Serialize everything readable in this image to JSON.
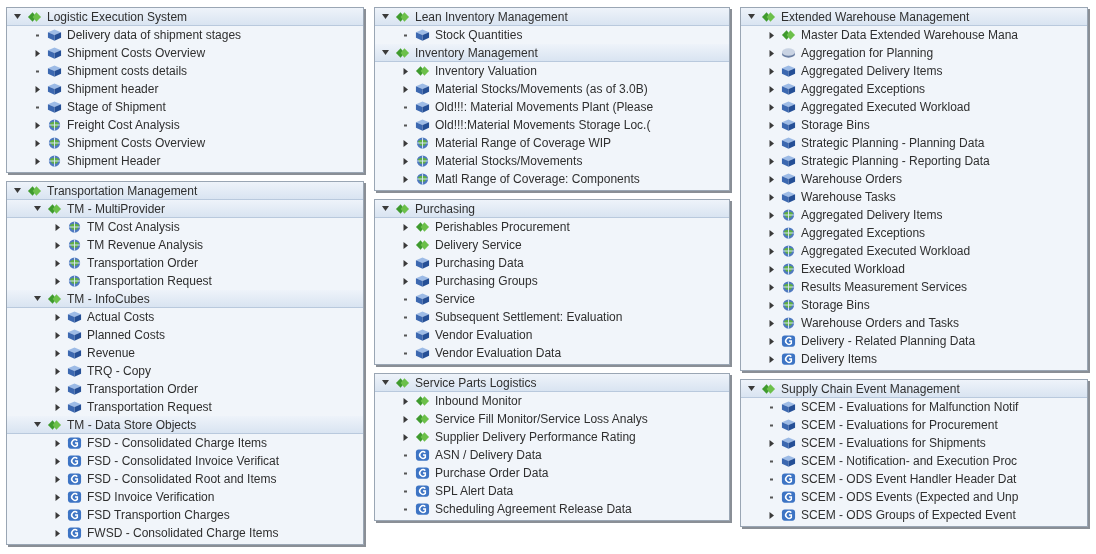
{
  "columns": [
    {
      "panels": [
        {
          "nodes": [
            {
              "label": "Logistic Execution System",
              "kind": "area",
              "expanded": true,
              "children": [
                {
                  "label": "Delivery data of shipment stages",
                  "kind": "cube",
                  "leaf": true
                },
                {
                  "label": "Shipment Costs Overview",
                  "kind": "cube",
                  "expanded": false
                },
                {
                  "label": "Shipment costs details",
                  "kind": "cube",
                  "leaf": true
                },
                {
                  "label": "Shipment header",
                  "kind": "cube",
                  "expanded": false
                },
                {
                  "label": "Stage of Shipment",
                  "kind": "cube",
                  "leaf": true
                },
                {
                  "label": "Freight Cost Analysis",
                  "kind": "multiprovider",
                  "expanded": false
                },
                {
                  "label": "Shipment Costs Overview",
                  "kind": "multiprovider",
                  "expanded": false
                },
                {
                  "label": "Shipment Header",
                  "kind": "multiprovider",
                  "expanded": false
                }
              ]
            }
          ]
        },
        {
          "nodes": [
            {
              "label": "Transportation Management",
              "kind": "area",
              "expanded": true,
              "children": [
                {
                  "label": "TM - MultiProvider",
                  "kind": "area",
                  "expanded": true,
                  "children": [
                    {
                      "label": "TM Cost Analysis",
                      "kind": "multiprovider",
                      "expanded": false
                    },
                    {
                      "label": "TM Revenue Analysis",
                      "kind": "multiprovider",
                      "expanded": false
                    },
                    {
                      "label": "Transportation Order",
                      "kind": "multiprovider",
                      "expanded": false
                    },
                    {
                      "label": "Transportation Request",
                      "kind": "multiprovider",
                      "expanded": false
                    }
                  ]
                },
                {
                  "label": "TM - InfoCubes",
                  "kind": "area",
                  "expanded": true,
                  "children": [
                    {
                      "label": "Actual Costs",
                      "kind": "cube",
                      "expanded": false
                    },
                    {
                      "label": "Planned Costs",
                      "kind": "cube",
                      "expanded": false
                    },
                    {
                      "label": "Revenue",
                      "kind": "cube",
                      "expanded": false
                    },
                    {
                      "label": "TRQ - Copy",
                      "kind": "cube",
                      "expanded": false
                    },
                    {
                      "label": "Transportation Order",
                      "kind": "cube",
                      "expanded": false
                    },
                    {
                      "label": "Transportation Request",
                      "kind": "cube",
                      "expanded": false
                    }
                  ]
                },
                {
                  "label": "TM - Data Store Objects",
                  "kind": "area",
                  "expanded": true,
                  "children": [
                    {
                      "label": "FSD - Consolidated Charge Items",
                      "kind": "dso",
                      "expanded": false
                    },
                    {
                      "label": "FSD - Consolidated Invoice Verificat",
                      "kind": "dso",
                      "expanded": false
                    },
                    {
                      "label": "FSD - Consolidated Root and Items",
                      "kind": "dso",
                      "expanded": false
                    },
                    {
                      "label": "FSD Invoice Verification",
                      "kind": "dso",
                      "expanded": false
                    },
                    {
                      "label": "FSD Transportion Charges",
                      "kind": "dso",
                      "expanded": false
                    },
                    {
                      "label": "FWSD - Consolidated Charge Items",
                      "kind": "dso",
                      "expanded": false
                    }
                  ]
                }
              ]
            }
          ]
        }
      ]
    },
    {
      "panels": [
        {
          "nodes": [
            {
              "label": "Lean Inventory Management",
              "kind": "area",
              "expanded": true,
              "children": [
                {
                  "label": "Stock Quantities",
                  "kind": "cube",
                  "leaf": true
                }
              ]
            },
            {
              "label": "Inventory Management",
              "kind": "area",
              "expanded": true,
              "children": [
                {
                  "label": "Inventory Valuation",
                  "kind": "area",
                  "expanded": false
                },
                {
                  "label": "Material Stocks/Movements (as of 3.0B)",
                  "kind": "cube",
                  "expanded": false
                },
                {
                  "label": "Old!!!: Material Movements Plant (Please",
                  "kind": "cube",
                  "leaf": true
                },
                {
                  "label": "Old!!!:Material Movements Storage Loc.(",
                  "kind": "cube",
                  "leaf": true
                },
                {
                  "label": "Material Range of Coverage WIP",
                  "kind": "multiprovider",
                  "expanded": false
                },
                {
                  "label": "Material Stocks/Movements",
                  "kind": "multiprovider",
                  "expanded": false
                },
                {
                  "label": "Matl Range of Coverage: Components",
                  "kind": "multiprovider",
                  "expanded": false
                }
              ]
            }
          ]
        },
        {
          "nodes": [
            {
              "label": "Purchasing",
              "kind": "area",
              "expanded": true,
              "children": [
                {
                  "label": "Perishables Procurement",
                  "kind": "area",
                  "expanded": false
                },
                {
                  "label": "Delivery Service",
                  "kind": "area",
                  "expanded": false
                },
                {
                  "label": "Purchasing Data",
                  "kind": "cube",
                  "expanded": false
                },
                {
                  "label": "Purchasing Groups",
                  "kind": "cube",
                  "expanded": false
                },
                {
                  "label": "Service",
                  "kind": "cube",
                  "leaf": true
                },
                {
                  "label": "Subsequent Settlement: Evaluation",
                  "kind": "cube",
                  "leaf": true
                },
                {
                  "label": "Vendor Evaluation",
                  "kind": "cube",
                  "leaf": true
                },
                {
                  "label": "Vendor Evaluation Data",
                  "kind": "cube",
                  "leaf": true
                }
              ]
            }
          ]
        },
        {
          "nodes": [
            {
              "label": "Service Parts Logistics",
              "kind": "area",
              "expanded": true,
              "children": [
                {
                  "label": "Inbound Monitor",
                  "kind": "area",
                  "expanded": false
                },
                {
                  "label": "Service Fill Monitor/Service Loss Analys",
                  "kind": "area",
                  "expanded": false
                },
                {
                  "label": "Supplier Delivery Performance Rating",
                  "kind": "area",
                  "expanded": false
                },
                {
                  "label": "ASN / Delivery Data",
                  "kind": "dso",
                  "leaf": true
                },
                {
                  "label": "Purchase Order Data",
                  "kind": "dso",
                  "leaf": true
                },
                {
                  "label": "SPL Alert Data",
                  "kind": "dso",
                  "leaf": true
                },
                {
                  "label": "Scheduling Agreement Release Data",
                  "kind": "dso",
                  "leaf": true
                }
              ]
            }
          ]
        }
      ]
    },
    {
      "panels": [
        {
          "nodes": [
            {
              "label": "Extended Warehouse Management",
              "kind": "area",
              "expanded": true,
              "children": [
                {
                  "label": "Master Data Extended Warehouse Mana",
                  "kind": "area",
                  "expanded": false
                },
                {
                  "label": "Aggregation for Planning",
                  "kind": "infoset",
                  "expanded": false
                },
                {
                  "label": "Aggregated Delivery Items",
                  "kind": "cube",
                  "expanded": false
                },
                {
                  "label": "Aggregated Exceptions",
                  "kind": "cube",
                  "expanded": false
                },
                {
                  "label": "Aggregated Executed Workload",
                  "kind": "cube",
                  "expanded": false
                },
                {
                  "label": "Storage Bins",
                  "kind": "cube",
                  "expanded": false
                },
                {
                  "label": "Strategic Planning - Planning Data",
                  "kind": "cube",
                  "expanded": false
                },
                {
                  "label": "Strategic Planning - Reporting Data",
                  "kind": "cube",
                  "expanded": false
                },
                {
                  "label": "Warehouse Orders",
                  "kind": "cube",
                  "expanded": false
                },
                {
                  "label": "Warehouse Tasks",
                  "kind": "cube",
                  "expanded": false
                },
                {
                  "label": "Aggregated Delivery Items",
                  "kind": "multiprovider",
                  "expanded": false
                },
                {
                  "label": "Aggregated Exceptions",
                  "kind": "multiprovider",
                  "expanded": false
                },
                {
                  "label": "Aggregated Executed Workload",
                  "kind": "multiprovider",
                  "expanded": false
                },
                {
                  "label": "Executed Workload",
                  "kind": "multiprovider",
                  "expanded": false
                },
                {
                  "label": "Results Measurement Services",
                  "kind": "multiprovider",
                  "expanded": false
                },
                {
                  "label": "Storage Bins",
                  "kind": "multiprovider",
                  "expanded": false
                },
                {
                  "label": "Warehouse Orders and Tasks",
                  "kind": "multiprovider",
                  "expanded": false
                },
                {
                  "label": "Delivery - Related Planning Data",
                  "kind": "dso",
                  "expanded": false
                },
                {
                  "label": "Delivery Items",
                  "kind": "dso",
                  "expanded": false
                }
              ]
            }
          ]
        },
        {
          "nodes": [
            {
              "label": "Supply Chain Event Management",
              "kind": "area",
              "expanded": true,
              "children": [
                {
                  "label": "SCEM - Evaluations for Malfunction Notif",
                  "kind": "cube",
                  "leaf": true
                },
                {
                  "label": "SCEM - Evaluations for Procurement",
                  "kind": "cube",
                  "leaf": true
                },
                {
                  "label": "SCEM - Evaluations for Shipments",
                  "kind": "cube",
                  "expanded": false
                },
                {
                  "label": "SCEM - Notification- and Execution Proc",
                  "kind": "cube",
                  "leaf": true
                },
                {
                  "label": "SCEM - ODS Event Handler Header Dat",
                  "kind": "dso",
                  "leaf": true
                },
                {
                  "label": "SCEM - ODS Events (Expected and Unp",
                  "kind": "dso",
                  "leaf": true
                },
                {
                  "label": "SCEM - ODS Groups of Expected Event",
                  "kind": "dso",
                  "expanded": false
                }
              ]
            }
          ]
        }
      ]
    }
  ]
}
